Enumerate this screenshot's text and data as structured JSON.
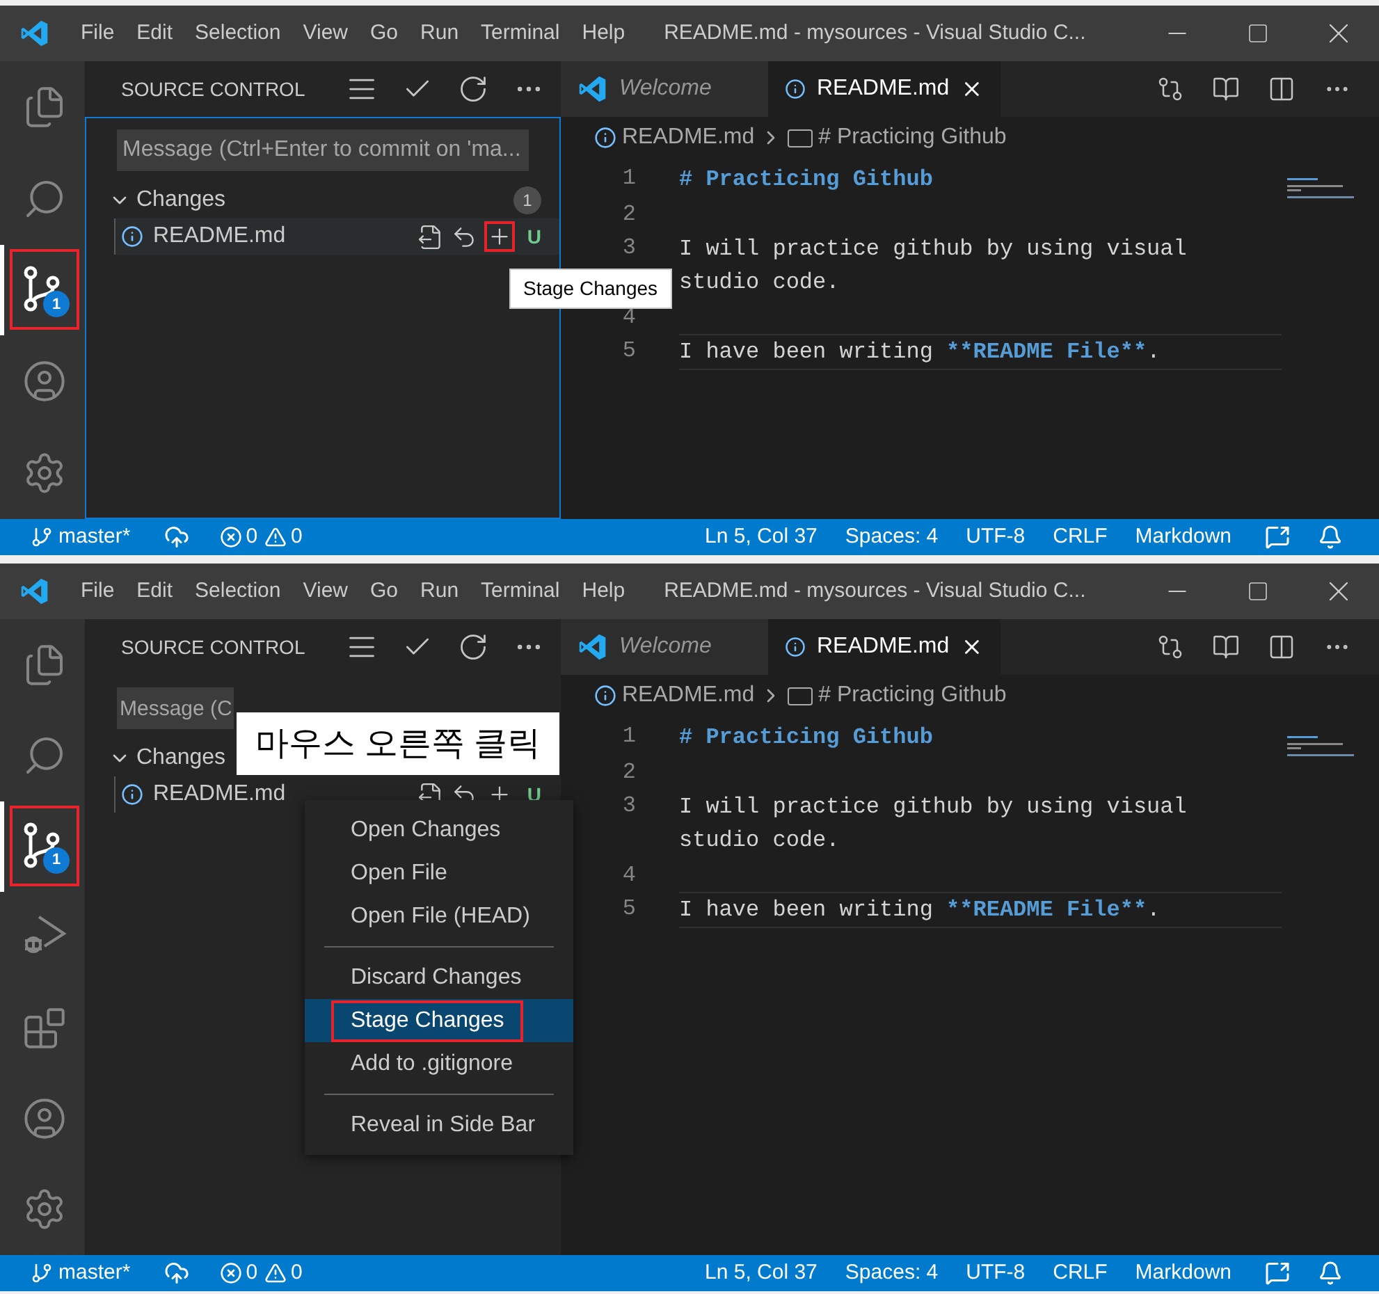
{
  "windows": [
    {
      "title": "README.md - mysources - Visual Studio C...",
      "menu": [
        "File",
        "Edit",
        "Selection",
        "View",
        "Go",
        "Run",
        "Terminal",
        "Help"
      ],
      "activity_bar": [
        {
          "kind": "explorer",
          "selected": false,
          "highlighted": false
        },
        {
          "kind": "search",
          "selected": false,
          "highlighted": false
        },
        {
          "kind": "scm",
          "selected": true,
          "highlighted": true,
          "badge": "1"
        },
        {
          "kind": "account",
          "selected": false,
          "highlighted": false
        },
        {
          "kind": "settings",
          "selected": false,
          "highlighted": false
        }
      ],
      "source_control": {
        "title": "SOURCE CONTROL",
        "message_placeholder": "Message (Ctrl+Enter to commit on 'ma...",
        "changes_label": "Changes",
        "changes_count": "1",
        "file": {
          "name": "README.md",
          "focused": true,
          "status": "U",
          "stage_highlighted": true
        }
      },
      "tabs": [
        {
          "label": "Welcome",
          "kind": "welcome",
          "selected": false
        },
        {
          "label": "README.md",
          "kind": "file",
          "selected": true
        }
      ],
      "breadcrumb": [
        "README.md",
        "# Practicing Github"
      ],
      "lines": [
        {
          "number": "1",
          "current": false,
          "segments": [
            {
              "text": "# Practicing Github",
              "kind": "heading"
            }
          ]
        },
        {
          "number": "2",
          "current": false
        },
        {
          "number": "3",
          "current": false,
          "segments": [
            {
              "text": "I will practice github by using visual studio code.",
              "kind": "plain"
            }
          ]
        },
        {
          "number": "4",
          "current": false
        },
        {
          "number": "5",
          "current": true,
          "segments": [
            {
              "text": "I have been writing ",
              "kind": "plain"
            },
            {
              "text": "**README File**",
              "kind": "emphasis"
            },
            {
              "text": ".",
              "kind": "plain"
            }
          ]
        }
      ],
      "status_bar": {
        "branch": "master*",
        "errors": "0",
        "warnings": "0",
        "right": [
          "Ln 5, Col 37",
          "Spaces: 4",
          "UTF-8",
          "CRLF",
          "Markdown"
        ]
      },
      "tooltip": "Stage Changes"
    },
    {
      "title": "README.md - mysources - Visual Studio C...",
      "menu": [
        "File",
        "Edit",
        "Selection",
        "View",
        "Go",
        "Run",
        "Terminal",
        "Help"
      ],
      "activity_bar": [
        {
          "kind": "explorer",
          "selected": false,
          "highlighted": false
        },
        {
          "kind": "search",
          "selected": false,
          "highlighted": false
        },
        {
          "kind": "scm",
          "selected": true,
          "highlighted": true,
          "badge": "1"
        },
        {
          "kind": "run",
          "selected": false,
          "highlighted": false
        },
        {
          "kind": "extensions",
          "selected": false,
          "highlighted": false
        },
        {
          "kind": "account",
          "selected": false,
          "highlighted": false
        },
        {
          "kind": "settings",
          "selected": false,
          "highlighted": false
        }
      ],
      "source_control": {
        "title": "SOURCE CONTROL",
        "message_placeholder": "Message (C",
        "changes_label": "Changes",
        "file": {
          "name": "README.md",
          "focused": false,
          "status": "U",
          "stage_highlighted": false
        }
      },
      "tabs": [
        {
          "label": "Welcome",
          "kind": "welcome",
          "selected": false
        },
        {
          "label": "README.md",
          "kind": "file",
          "selected": true
        }
      ],
      "breadcrumb": [
        "README.md",
        "# Practicing Github"
      ],
      "lines": [
        {
          "number": "1",
          "current": false,
          "segments": [
            {
              "text": "# Practicing Github",
              "kind": "heading"
            }
          ]
        },
        {
          "number": "2",
          "current": false
        },
        {
          "number": "3",
          "current": false,
          "segments": [
            {
              "text": "I will practice github by using visual studio code.",
              "kind": "plain"
            }
          ]
        },
        {
          "number": "4",
          "current": false
        },
        {
          "number": "5",
          "current": true,
          "segments": [
            {
              "text": "I have been writing ",
              "kind": "plain"
            },
            {
              "text": "**README File**",
              "kind": "emphasis"
            },
            {
              "text": ".",
              "kind": "plain"
            }
          ]
        }
      ],
      "status_bar": {
        "branch": "master*",
        "errors": "0",
        "warnings": "0",
        "right": [
          "Ln 5, Col 37",
          "Spaces: 4",
          "UTF-8",
          "CRLF",
          "Markdown"
        ]
      },
      "annotation": "마우스 오른쪽 클릭",
      "context_menu": [
        {
          "items": [
            {
              "label": "Open Changes",
              "selected": false,
              "highlighted": false
            },
            {
              "label": "Open File",
              "selected": false,
              "highlighted": false
            },
            {
              "label": "Open File (HEAD)",
              "selected": false,
              "highlighted": false
            }
          ]
        },
        {
          "items": [
            {
              "label": "Discard Changes",
              "selected": false,
              "highlighted": false
            },
            {
              "label": "Stage Changes",
              "selected": true,
              "highlighted": true
            },
            {
              "label": "Add to .gitignore",
              "selected": false,
              "highlighted": false
            }
          ]
        },
        {
          "items": [
            {
              "label": "Reveal in Side Bar",
              "selected": false,
              "highlighted": false
            }
          ]
        }
      ]
    }
  ]
}
